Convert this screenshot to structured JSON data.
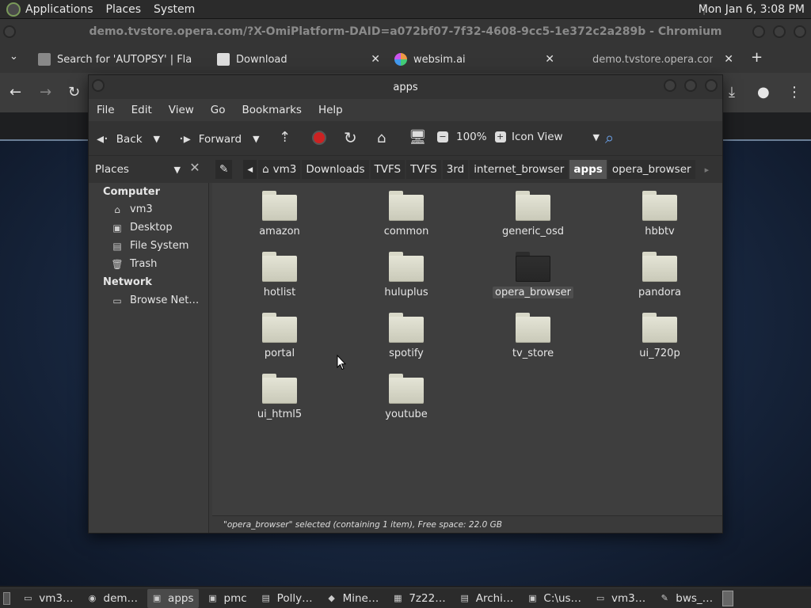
{
  "top_panel": {
    "menus": [
      "Applications",
      "Places",
      "System"
    ],
    "clock": "Mon Jan  6,  3:08 PM"
  },
  "chromium": {
    "window_title": "demo.tvstore.opera.com/?X-OmiPlatform-DAID=a072bf07-7f32-4608-9cc5-1e372c2a289b - Chromium",
    "tabs": [
      {
        "title": "Search for 'AUTOPSY' | Fla"
      },
      {
        "title": "Download"
      },
      {
        "title": "websim.ai"
      },
      {
        "title": "demo.tvstore.opera.com/?"
      }
    ]
  },
  "file_manager": {
    "title": "apps",
    "menu": [
      "File",
      "Edit",
      "View",
      "Go",
      "Bookmarks",
      "Help"
    ],
    "toolbar": {
      "back": "Back",
      "forward": "Forward",
      "zoom": "100%",
      "view_mode": "Icon View"
    },
    "places_label": "Places",
    "breadcrumbs": [
      "vm3",
      "Downloads",
      "TVFS",
      "TVFS",
      "3rd",
      "internet_browser",
      "apps",
      "opera_browser"
    ],
    "active_crumb": "apps",
    "sidebar": {
      "computer_heading": "Computer",
      "computer_items": [
        "vm3",
        "Desktop",
        "File System",
        "Trash"
      ],
      "network_heading": "Network",
      "network_items": [
        "Browse Net…"
      ]
    },
    "folders": [
      "amazon",
      "common",
      "generic_osd",
      "hbbtv",
      "hotlist",
      "huluplus",
      "opera_browser",
      "pandora",
      "portal",
      "spotify",
      "tv_store",
      "ui_720p",
      "ui_html5",
      "youtube"
    ],
    "selected_folder": "opera_browser",
    "status": "\"opera_browser\" selected (containing 1 item), Free space: 22.0 GB"
  },
  "taskbar": {
    "items": [
      "vm3…",
      "dem…",
      "apps",
      "pmc",
      "Polly…",
      "Mine…",
      "7z22…",
      "Archi…",
      "C:\\us…",
      "vm3…",
      "bws_…"
    ],
    "active": "apps"
  }
}
